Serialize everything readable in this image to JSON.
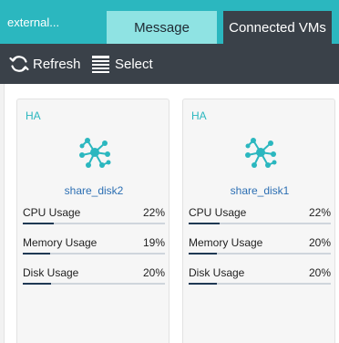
{
  "window": {
    "title": "external..."
  },
  "tabs": [
    {
      "label": "Message"
    },
    {
      "label": "Connected VMs"
    }
  ],
  "toolbar": {
    "refresh_label": "Refresh",
    "refresh_icon": "refresh-icon",
    "select_label": "Select",
    "select_icon": "list-select-icon"
  },
  "colors": {
    "accent": "#2bb7bf",
    "toolbar_bg": "#3a4149",
    "progress_fill": "#1f3954",
    "link": "#2c6fb3"
  },
  "vms": [
    {
      "badge": "HA",
      "icon": "network-nodes-icon",
      "name": "share_disk2",
      "metrics": [
        {
          "label": "CPU Usage",
          "value": "22%",
          "level": 0.22
        },
        {
          "label": "Memory Usage",
          "value": "19%",
          "level": 0.19
        },
        {
          "label": "Disk Usage",
          "value": "20%",
          "level": 0.2
        }
      ]
    },
    {
      "badge": "HA",
      "icon": "network-nodes-icon",
      "name": "share_disk1",
      "metrics": [
        {
          "label": "CPU Usage",
          "value": "22%",
          "level": 0.22
        },
        {
          "label": "Memory Usage",
          "value": "20%",
          "level": 0.2
        },
        {
          "label": "Disk Usage",
          "value": "20%",
          "level": 0.2
        }
      ]
    }
  ]
}
